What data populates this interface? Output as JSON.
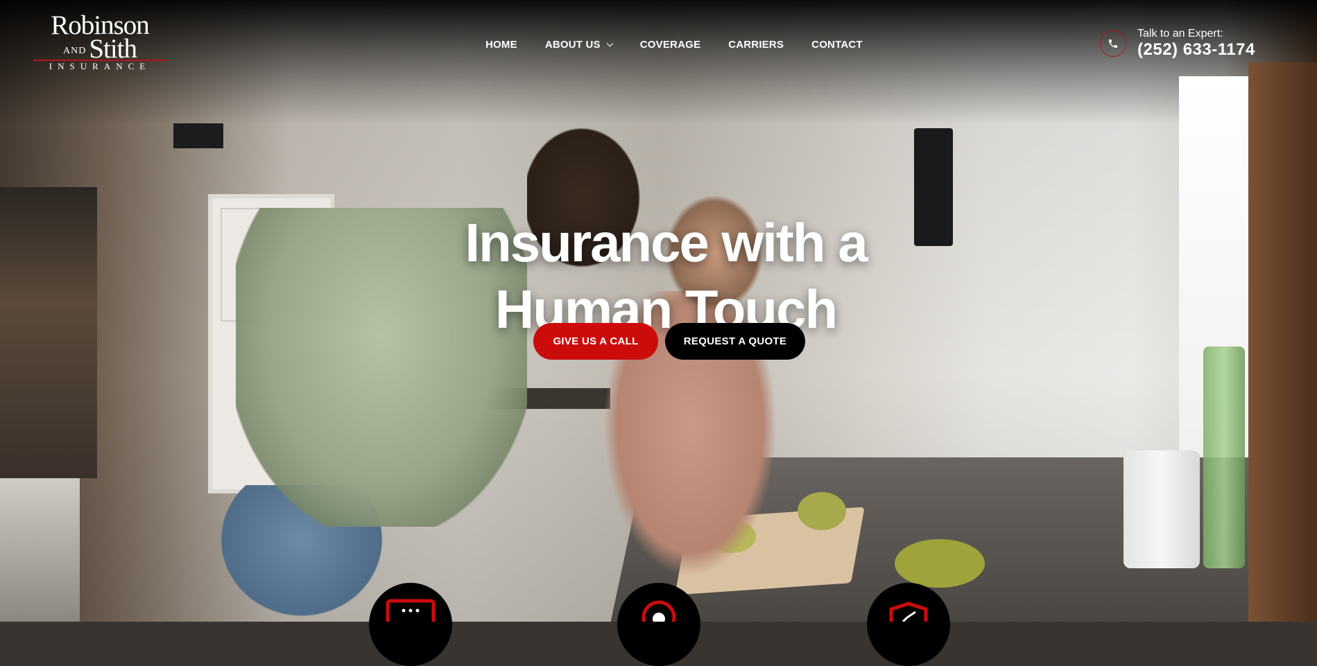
{
  "logo": {
    "line1": "Robinson",
    "line2_and": "AND",
    "line2": "Stith",
    "line3": "INSURANCE"
  },
  "nav": {
    "items": [
      {
        "label": "HOME"
      },
      {
        "label": "ABOUT US"
      },
      {
        "label": "COVERAGE"
      },
      {
        "label": "CARRIERS"
      },
      {
        "label": "CONTACT"
      }
    ]
  },
  "contact": {
    "label": "Talk to an Expert:",
    "phone": "(252) 633-1174",
    "icon": "phone-icon"
  },
  "hero": {
    "headline_line1": "Insurance with a",
    "headline_line2": "Human Touch",
    "call_button": "GIVE US A CALL",
    "quote_button": "REQUEST A QUOTE"
  },
  "features": [
    {
      "icon": "chat-bubble-icon"
    },
    {
      "icon": "location-pin-icon"
    },
    {
      "icon": "shield-check-icon"
    }
  ],
  "colors": {
    "accent_red": "#cc0b0b",
    "black": "#000000",
    "white": "#ffffff"
  }
}
